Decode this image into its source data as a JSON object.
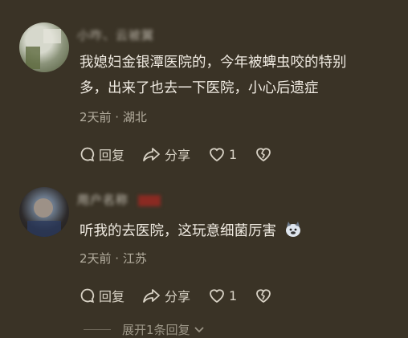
{
  "comments": [
    {
      "username": "小咋、云被翼",
      "content_line1": "我媳妇金银潭医院的，今年被蜱虫咬的特别",
      "content_line2": "多，出来了也去一下医院，小心后遗症",
      "meta": "2天前 · 湖北",
      "reply_label": "回复",
      "share_label": "分享",
      "likes": "1"
    },
    {
      "username": "用户名称",
      "content": "听我的去医院，这玩意细菌厉害",
      "meta": "2天前 · 江苏",
      "reply_label": "回复",
      "share_label": "分享",
      "likes": "1"
    }
  ],
  "expand_label": "展开1条回复"
}
